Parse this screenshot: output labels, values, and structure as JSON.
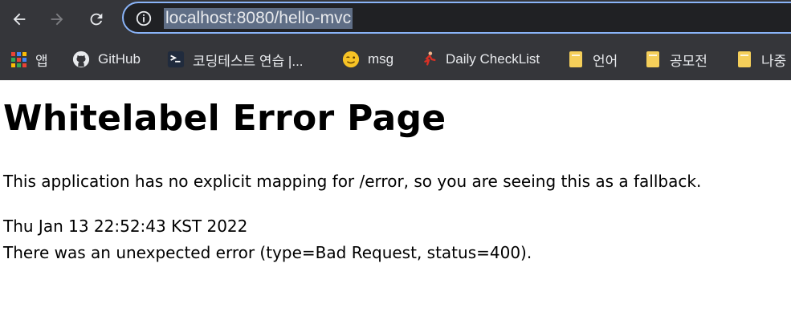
{
  "browser": {
    "address_bar": {
      "url": "localhost:8080/hello-mvc"
    },
    "bookmarks": [
      {
        "label": "앱",
        "icon": "apps-grid-icon"
      },
      {
        "label": "GitHub",
        "icon": "github-icon"
      },
      {
        "label": "코딩테스트 연습 |...",
        "icon": "programmers-icon"
      },
      {
        "label": "msg",
        "icon": "winking-face-icon"
      },
      {
        "label": "Daily CheckList",
        "icon": "runner-icon"
      },
      {
        "label": "언어",
        "icon": "folder-icon"
      },
      {
        "label": "공모전",
        "icon": "folder-icon"
      },
      {
        "label": "나중",
        "icon": "folder-icon"
      }
    ]
  },
  "page": {
    "title": "Whitelabel Error Page",
    "message": "This application has no explicit mapping for /error, so you are seeing this as a fallback.",
    "timestamp": "Thu Jan 13 22:52:43 KST 2022",
    "error": "There was an unexpected error (type=Bad Request, status=400)."
  },
  "colors": {
    "chrome_bg": "#35363a",
    "omnibox_border": "#8ab4f8",
    "url_selection": "#5f6e86"
  }
}
